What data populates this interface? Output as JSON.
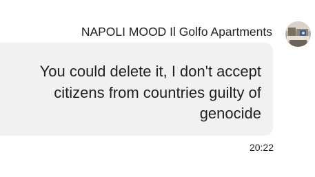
{
  "message": {
    "sender": "NAPOLI MOOD Il Golfo Apartments",
    "text": "You could delete it, I don't accept\ncitizens from countries guilty of\ngenocide",
    "time": "20:22",
    "avatar_icon": "sender-profile-photo"
  },
  "colors": {
    "bubble_background": "#f1f1f1",
    "text": "#202124",
    "page_background": "#ffffff"
  }
}
